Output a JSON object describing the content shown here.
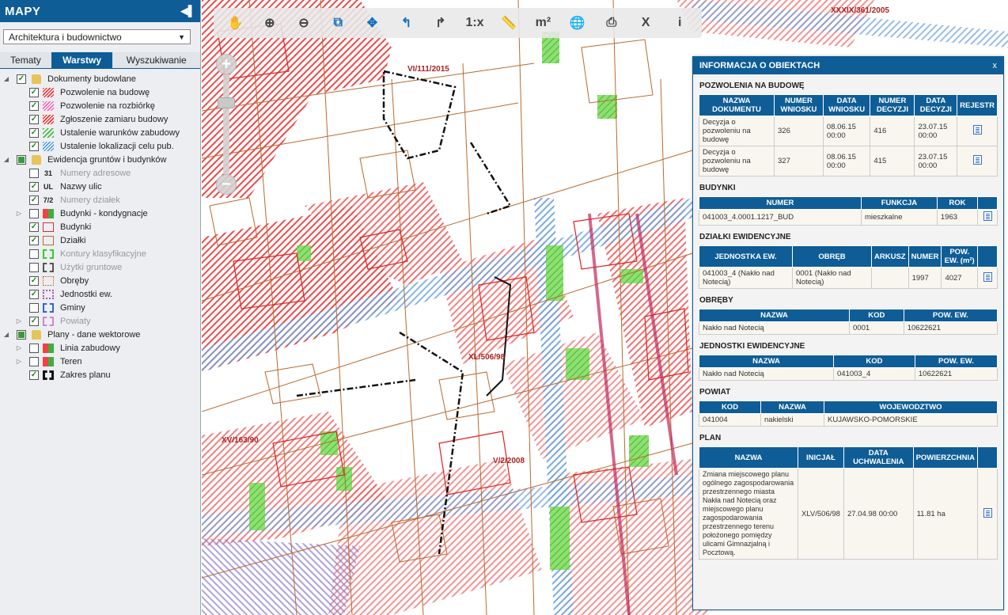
{
  "app": {
    "title": "MAPY",
    "collapse_icon": "arrow-left-icon"
  },
  "category_select": {
    "value": "Architektura i budownictwo"
  },
  "tabs": [
    {
      "label": "Tematy",
      "active": false
    },
    {
      "label": "Warstwy",
      "active": true
    },
    {
      "label": "Wyszukiwanie",
      "active": false
    }
  ],
  "tree": [
    {
      "label": "Dokumenty budowlane",
      "folder": true,
      "state": "checked",
      "expand": "open"
    },
    {
      "label": "Pozwolenie na budowę",
      "state": "checked",
      "symbol": "hatch-red"
    },
    {
      "label": "Pozwolenie na rozbiórkę",
      "state": "checked",
      "symbol": "hatch-pink"
    },
    {
      "label": "Zgłoszenie zamiaru budowy",
      "state": "checked",
      "symbol": "hatch-red"
    },
    {
      "label": "Ustalenie warunków zabudowy",
      "state": "checked",
      "symbol": "hatch-green"
    },
    {
      "label": "Ustalenie lokalizacji celu pub.",
      "state": "checked",
      "symbol": "hatch-blue"
    },
    {
      "label": "Ewidencja gruntów i budynków",
      "folder": true,
      "state": "partial",
      "expand": "open"
    },
    {
      "label": "Numery adresowe",
      "state": "unchecked",
      "symbol_text": "31",
      "grey": true
    },
    {
      "label": "Nazwy ulic",
      "state": "checked",
      "symbol_text": "UL"
    },
    {
      "label": "Numery działek",
      "state": "checked",
      "symbol_text": "7/2",
      "grey": true
    },
    {
      "label": "Budynki - kondygnacje",
      "state": "unchecked",
      "symbol": "multi",
      "expand": "closed"
    },
    {
      "label": "Budynki",
      "state": "checked",
      "symbol": "box-red"
    },
    {
      "label": "Działki",
      "state": "checked",
      "symbol": "box-brown"
    },
    {
      "label": "Kontury klasyfikacyjne",
      "state": "unchecked",
      "symbol": "dash-green",
      "grey": true
    },
    {
      "label": "Użytki gruntowe",
      "state": "unchecked",
      "symbol": "dash-black",
      "grey": true
    },
    {
      "label": "Obręby",
      "state": "checked",
      "symbol": "dot-orange"
    },
    {
      "label": "Jednostki ew.",
      "state": "checked",
      "symbol": "dot-purple"
    },
    {
      "label": "Gminy",
      "state": "unchecked",
      "symbol": "dash-blue"
    },
    {
      "label": "Powiaty",
      "state": "checked",
      "symbol": "dash-pink",
      "grey": true,
      "expand": "closed"
    },
    {
      "label": "Plany - dane wektorowe",
      "folder": true,
      "state": "partial",
      "expand": "open"
    },
    {
      "label": "Linia zabudowy",
      "state": "unchecked",
      "symbol": "multi",
      "expand": "closed"
    },
    {
      "label": "Teren",
      "state": "unchecked",
      "symbol": "multi",
      "expand": "closed"
    },
    {
      "label": "Zakres planu",
      "state": "checked",
      "symbol": "thick-black"
    }
  ],
  "toolbar": [
    {
      "name": "pan-icon",
      "glyph": "✋"
    },
    {
      "name": "zoom-in-icon",
      "glyph": "⊕"
    },
    {
      "name": "zoom-out-icon",
      "glyph": "⊖"
    },
    {
      "name": "zoom-box-icon",
      "glyph": "⧉",
      "blue": true
    },
    {
      "name": "move-icon",
      "glyph": "✥",
      "blue": true
    },
    {
      "name": "undo-icon",
      "glyph": "↰",
      "blue": true
    },
    {
      "name": "redo-icon",
      "glyph": "↱"
    },
    {
      "name": "scale-label",
      "glyph": "1:x"
    },
    {
      "name": "measure-length-icon",
      "glyph": "📏"
    },
    {
      "name": "measure-area-label",
      "glyph": "m²"
    },
    {
      "name": "globe-search-icon",
      "glyph": "🌐"
    },
    {
      "name": "print-icon",
      "glyph": "⎙"
    },
    {
      "name": "close-x-icon",
      "glyph": "X"
    },
    {
      "name": "info-icon",
      "glyph": "i"
    }
  ],
  "zoom": {
    "plus": "+",
    "minus": "−"
  },
  "map_labels": [
    {
      "text": "VI/111/2015"
    },
    {
      "text": "XXXIX/361/2005"
    },
    {
      "text": "XL/506/98"
    },
    {
      "text": "XV/163/90"
    },
    {
      "text": "V/2/2008"
    }
  ],
  "info": {
    "title": "INFORMACJA O OBIEKTACH",
    "close": "x",
    "sections": {
      "pozwolenia": {
        "title": "POZWOLENIA NA BUDOWĘ",
        "headers": [
          "NAZWA DOKUMENTU",
          "NUMER WNIOSKU",
          "DATA WNIOSKU",
          "NUMER DECYZJI",
          "DATA DECYZJI",
          "REJESTR"
        ],
        "rows": [
          [
            "Decyzja o pozwoleniu na budowę",
            "326",
            "08.06.15 00:00",
            "416",
            "23.07.15 00:00"
          ],
          [
            "Decyzja o pozwoleniu na budowę",
            "327",
            "08.06.15 00:00",
            "415",
            "23.07.15 00:00"
          ]
        ]
      },
      "budynki": {
        "title": "BUDYNKI",
        "headers": [
          "NUMER",
          "FUNKCJA",
          "ROK",
          ""
        ],
        "rows": [
          [
            "041003_4.0001.1217_BUD",
            "mieszkalne",
            "1963"
          ]
        ]
      },
      "dzialki": {
        "title": "DZIAŁKI EWIDENCYJNE",
        "headers": [
          "JEDNOSTKA EW.",
          "OBRĘB",
          "ARKUSZ",
          "NUMER",
          "POW. EW. (m²)",
          ""
        ],
        "rows": [
          [
            "041003_4 (Nakło nad Notecią)",
            "0001 (Nakło nad Notecią)",
            "",
            "1997",
            "4027"
          ]
        ]
      },
      "obreby": {
        "title": "OBRĘBY",
        "headers": [
          "NAZWA",
          "KOD",
          "POW. EW."
        ],
        "rows": [
          [
            "Nakło nad Notecią",
            "0001",
            "10622621"
          ]
        ]
      },
      "jednostki": {
        "title": "JEDNOSTKI EWIDENCYJNE",
        "headers": [
          "NAZWA",
          "KOD",
          "POW. EW."
        ],
        "rows": [
          [
            "Nakło nad Notecią",
            "041003_4",
            "10622621"
          ]
        ]
      },
      "powiat": {
        "title": "POWIAT",
        "headers": [
          "KOD",
          "NAZWA",
          "WOJEWODZTWO"
        ],
        "rows": [
          [
            "041004",
            "nakielski",
            "KUJAWSKO-POMORSKIE"
          ]
        ]
      },
      "plan": {
        "title": "PLAN",
        "headers": [
          "NAZWA",
          "INICJAŁ",
          "DATA UCHWALENIA",
          "POWIERZCHNIA",
          ""
        ],
        "rows": [
          [
            "Zmiana miejscowego planu ogólnego zagospodarowania przestrzennego miasta Nakła nad Notecią oraz miejscowego planu zagospodarowania przestrzennego terenu położonego pomiędzy ulicami Gimnazjalną i Pocztową.",
            "XLV/506/98",
            "27.04.98 00:00",
            "11.81 ha"
          ]
        ]
      }
    }
  },
  "colors": {
    "brand": "#0e5d96",
    "hatch_red": "#e33333",
    "green_area": "#7ddc5a",
    "blue_hatch": "#5a96dc"
  }
}
